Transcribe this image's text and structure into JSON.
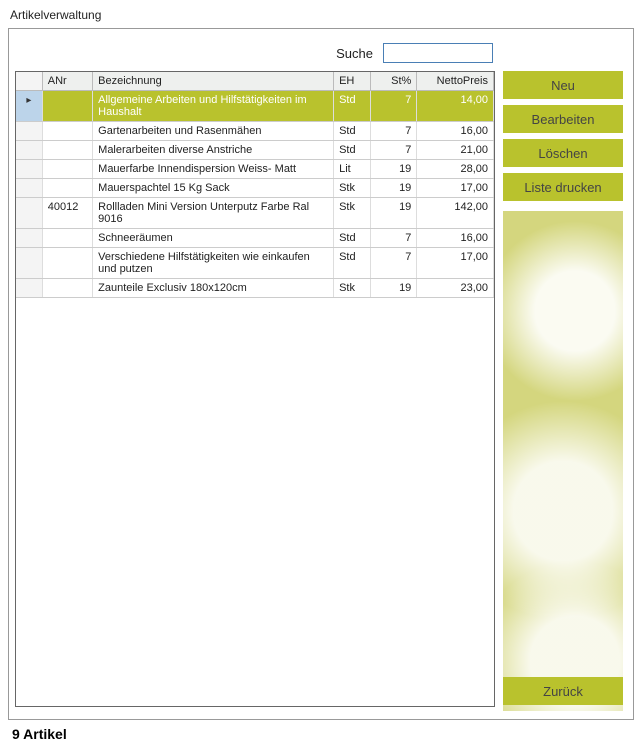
{
  "window": {
    "title": "Artikelverwaltung"
  },
  "search": {
    "label": "Suche",
    "value": "",
    "placeholder": ""
  },
  "buttons": {
    "neu": "Neu",
    "bearbeiten": "Bearbeiten",
    "loeschen": "Löschen",
    "drucken": "Liste drucken",
    "zurueck": "Zurück"
  },
  "table": {
    "headers": {
      "sel": "",
      "anr": "ANr",
      "bez": "Bezeichnung",
      "eh": "EH",
      "st": "St%",
      "preis": "NettoPreis"
    },
    "rows": [
      {
        "selected": true,
        "anr": "",
        "bez": "Allgemeine Arbeiten und Hilfstätigkeiten im Haushalt",
        "eh": "Std",
        "st": "7",
        "preis": "14,00"
      },
      {
        "selected": false,
        "anr": "",
        "bez": "Gartenarbeiten und Rasenmähen",
        "eh": "Std",
        "st": "7",
        "preis": "16,00"
      },
      {
        "selected": false,
        "anr": "",
        "bez": "Malerarbeiten diverse Anstriche",
        "eh": "Std",
        "st": "7",
        "preis": "21,00"
      },
      {
        "selected": false,
        "anr": "",
        "bez": "Mauerfarbe Innendispersion Weiss- Matt",
        "eh": "Lit",
        "st": "19",
        "preis": "28,00"
      },
      {
        "selected": false,
        "anr": "",
        "bez": "Mauerspachtel 15 Kg Sack",
        "eh": "Stk",
        "st": "19",
        "preis": "17,00"
      },
      {
        "selected": false,
        "anr": "40012",
        "bez": "Rollladen Mini Version Unterputz Farbe Ral 9016",
        "eh": "Stk",
        "st": "19",
        "preis": "142,00"
      },
      {
        "selected": false,
        "anr": "",
        "bez": "Schneeräumen",
        "eh": "Std",
        "st": "7",
        "preis": "16,00"
      },
      {
        "selected": false,
        "anr": "",
        "bez": "Verschiedene Hilfstätigkeiten wie einkaufen und putzen",
        "eh": "Std",
        "st": "7",
        "preis": "17,00"
      },
      {
        "selected": false,
        "anr": "",
        "bez": "Zaunteile Exclusiv 180x120cm",
        "eh": "Stk",
        "st": "19",
        "preis": "23,00"
      }
    ]
  },
  "footer": {
    "count_text": "9 Artikel"
  }
}
